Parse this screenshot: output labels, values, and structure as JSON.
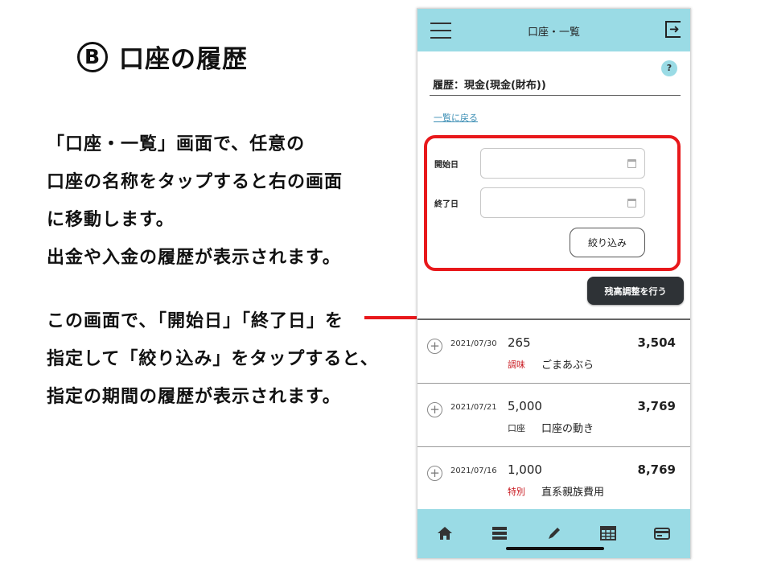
{
  "left": {
    "badge": "B",
    "heading": "口座の履歴",
    "para1": [
      "「口座・一覧」画面で、任意の",
      "口座の名称をタップすると右の画面",
      "に移動します。",
      "出金や入金の履歴が表示されます。"
    ],
    "para2": [
      "この画面で､「開始日」「終了日」を",
      "指定して「絞り込み」をタップすると､",
      "指定の期間の履歴が表示されます。"
    ]
  },
  "colors": {
    "accent": "#9adbe5",
    "highlight": "#e8181b",
    "category_red": "#c8171e"
  },
  "phone": {
    "topbar_title": "口座・一覧",
    "help": "?",
    "history_title": "履歴：現金(現金(財布))",
    "back_link": "一覧に戻る",
    "start_label": "開始日",
    "end_label": "終了日",
    "filter_button": "絞り込み",
    "adjust_button": "残高調整を行う",
    "rows": [
      {
        "date": "2021/07/30",
        "amount": "265",
        "total": "3,504",
        "category": "調味",
        "memo": "ごまあぶら",
        "category_color": "#c8171e"
      },
      {
        "date": "2021/07/21",
        "amount": "5,000",
        "total": "3,769",
        "category": "口座",
        "memo": "口座の動き",
        "category_color": "#333333"
      },
      {
        "date": "2021/07/16",
        "amount": "1,000",
        "total": "8,769",
        "category": "特別",
        "memo": "直系親族費用",
        "category_color": "#c8171e"
      }
    ],
    "nav_icons": [
      "home-icon",
      "list-icon",
      "pen-icon",
      "calendar-icon",
      "card-icon"
    ]
  }
}
